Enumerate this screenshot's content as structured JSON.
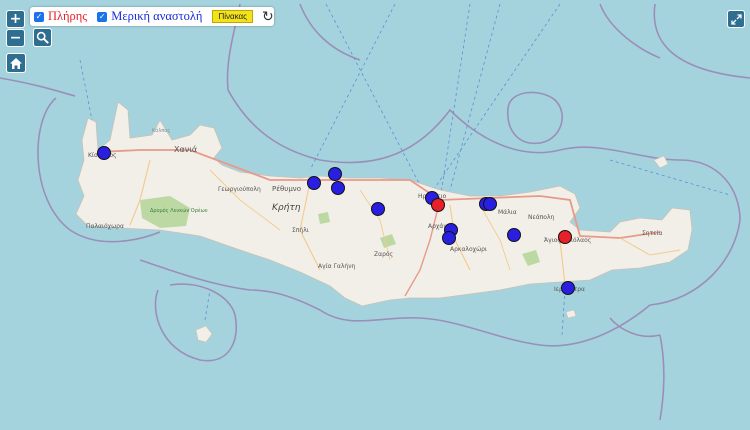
{
  "filters": {
    "full": {
      "label": "Πλήρης",
      "checked": true,
      "color": "#e8202a"
    },
    "partial": {
      "label": "Μερική αναστολή",
      "checked": true,
      "color": "#1a2bd6"
    },
    "table_button": "Πίνακας",
    "refresh_icon": "refresh-icon"
  },
  "controls": {
    "zoom_in": "+",
    "zoom_out": "−",
    "search_icon": "magnifier-icon",
    "home_icon": "home-icon",
    "expand_icon": "expand-icon"
  },
  "map_labels": {
    "chania": "Χανιά",
    "rethymno": "Ρέθυμνο",
    "georgioupoli": "Γεωργιούπολη",
    "crete": "Κρήτη",
    "spili": "Σπήλι",
    "agia_galini": "Αγία Γαλήνη",
    "zaros": "Ζαρός",
    "arkalochori": "Αρκαλοχώρι",
    "malia": "Μάλια",
    "neapoli": "Νεάπολη",
    "agios_nikolaos": "Άγιος Νικόλαος",
    "sitia": "Σητεία",
    "ierapetra": "Ιεράπετρα",
    "palaiochora": "Παλαιόχωρα",
    "kissamos": "Κίσσαμος",
    "heraklion": "Ηράκλειο",
    "archanes": "Αρχάνες",
    "samaria": "Δρυμός Λευκών Ορέων",
    "akrotiri": "Κόλπος"
  },
  "colors": {
    "sea": "#a5d3dd",
    "land": "#f2efe9",
    "red_marker": "#e8202a",
    "blue_marker": "#2a1fe0"
  }
}
